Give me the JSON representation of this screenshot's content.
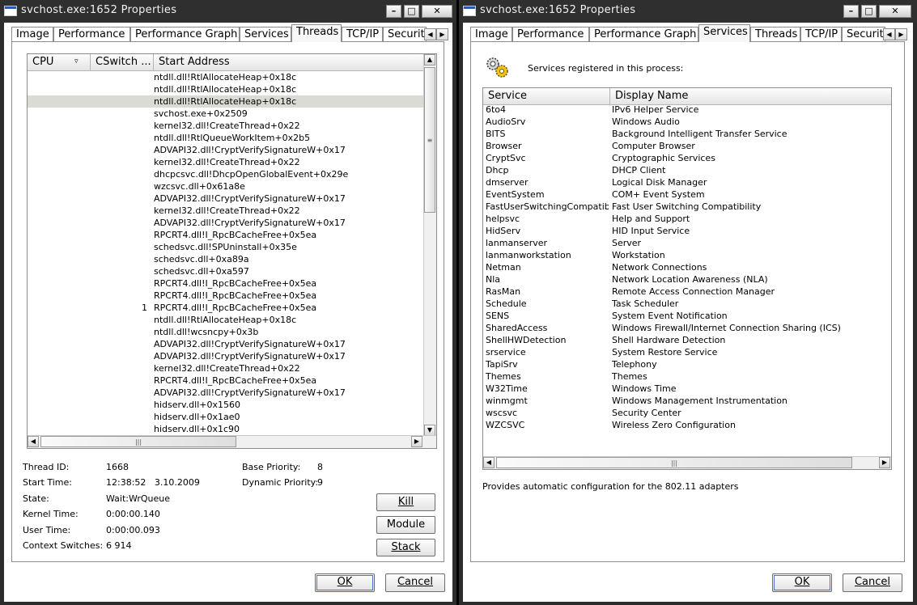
{
  "left": {
    "title": "svchost.exe:1652 Properties",
    "tabs": [
      "Image",
      "Performance",
      "Performance Graph",
      "Services",
      "Threads",
      "TCP/IP",
      "Securit"
    ],
    "selected_tab": "Threads",
    "columns": [
      "CPU",
      "CSwitch ...",
      "Start Address"
    ],
    "threads": [
      {
        "cpu": "",
        "cs": "",
        "addr": "ntdll.dll!RtlAllocateHeap+0x18c"
      },
      {
        "cpu": "",
        "cs": "",
        "addr": "ntdll.dll!RtlAllocateHeap+0x18c"
      },
      {
        "cpu": "",
        "cs": "",
        "addr": "ntdll.dll!RtlAllocateHeap+0x18c"
      },
      {
        "cpu": "",
        "cs": "",
        "addr": "svchost.exe+0x2509"
      },
      {
        "cpu": "",
        "cs": "",
        "addr": "kernel32.dll!CreateThread+0x22"
      },
      {
        "cpu": "",
        "cs": "",
        "addr": "ntdll.dll!RtlQueueWorkItem+0x2b5"
      },
      {
        "cpu": "",
        "cs": "",
        "addr": "ADVAPI32.dll!CryptVerifySignatureW+0x17"
      },
      {
        "cpu": "",
        "cs": "",
        "addr": "kernel32.dll!CreateThread+0x22"
      },
      {
        "cpu": "",
        "cs": "",
        "addr": "dhcpcsvc.dll!DhcpOpenGlobalEvent+0x29e"
      },
      {
        "cpu": "",
        "cs": "",
        "addr": "wzcsvc.dll+0x61a8e"
      },
      {
        "cpu": "",
        "cs": "",
        "addr": "ADVAPI32.dll!CryptVerifySignatureW+0x17"
      },
      {
        "cpu": "",
        "cs": "",
        "addr": "kernel32.dll!CreateThread+0x22"
      },
      {
        "cpu": "",
        "cs": "",
        "addr": "ADVAPI32.dll!CryptVerifySignatureW+0x17"
      },
      {
        "cpu": "",
        "cs": "",
        "addr": "RPCRT4.dll!I_RpcBCacheFree+0x5ea"
      },
      {
        "cpu": "",
        "cs": "",
        "addr": "schedsvc.dll!SPUninstall+0x35e"
      },
      {
        "cpu": "",
        "cs": "",
        "addr": "schedsvc.dll+0xa89a"
      },
      {
        "cpu": "",
        "cs": "",
        "addr": "schedsvc.dll+0xa597"
      },
      {
        "cpu": "",
        "cs": "",
        "addr": "RPCRT4.dll!I_RpcBCacheFree+0x5ea"
      },
      {
        "cpu": "",
        "cs": "",
        "addr": "RPCRT4.dll!I_RpcBCacheFree+0x5ea"
      },
      {
        "cpu": "",
        "cs": "1",
        "addr": "RPCRT4.dll!I_RpcBCacheFree+0x5ea"
      },
      {
        "cpu": "",
        "cs": "",
        "addr": "ntdll.dll!RtlAllocateHeap+0x18c"
      },
      {
        "cpu": "",
        "cs": "",
        "addr": "ntdll.dll!wcsncpy+0x3b"
      },
      {
        "cpu": "",
        "cs": "",
        "addr": "ADVAPI32.dll!CryptVerifySignatureW+0x17"
      },
      {
        "cpu": "",
        "cs": "",
        "addr": "ADVAPI32.dll!CryptVerifySignatureW+0x17"
      },
      {
        "cpu": "",
        "cs": "",
        "addr": "kernel32.dll!CreateThread+0x22"
      },
      {
        "cpu": "",
        "cs": "",
        "addr": "RPCRT4.dll!I_RpcBCacheFree+0x5ea"
      },
      {
        "cpu": "",
        "cs": "",
        "addr": "ADVAPI32.dll!CryptVerifySignatureW+0x17"
      },
      {
        "cpu": "",
        "cs": "",
        "addr": "hidserv.dll+0x1560"
      },
      {
        "cpu": "",
        "cs": "",
        "addr": "hidserv.dll+0x1ae0"
      },
      {
        "cpu": "",
        "cs": "",
        "addr": "hidserv.dll+0x1c90"
      }
    ],
    "details": {
      "thread_id_label": "Thread ID:",
      "thread_id": "1668",
      "start_time_label": "Start Time:",
      "start_time": "12:38:52   3.10.2009",
      "state_label": "State:",
      "state": "Wait:WrQueue",
      "kernel_time_label": "Kernel Time:",
      "kernel_time": "0:00:00.140",
      "user_time_label": "User Time:",
      "user_time": "0:00:00.093",
      "context_switches_label": "Context Switches:",
      "context_switches": "6 914",
      "base_priority_label": "Base Priority:",
      "base_priority": "8",
      "dynamic_priority_label": "Dynamic Priority:",
      "dynamic_priority": "9"
    },
    "buttons": {
      "kill": "Kill",
      "module": "Module",
      "stack": "Stack",
      "ok": "OK",
      "cancel": "Cancel"
    }
  },
  "right": {
    "title": "svchost.exe:1652 Properties",
    "tabs": [
      "Image",
      "Performance",
      "Performance Graph",
      "Services",
      "Threads",
      "TCP/IP",
      "Securit"
    ],
    "selected_tab": "Services",
    "heading": "Services registered in this process:",
    "columns": [
      "Service",
      "Display Name"
    ],
    "services": [
      {
        "name": "6to4",
        "display": "IPv6 Helper Service"
      },
      {
        "name": "AudioSrv",
        "display": "Windows Audio"
      },
      {
        "name": "BITS",
        "display": "Background Intelligent Transfer Service"
      },
      {
        "name": "Browser",
        "display": "Computer Browser"
      },
      {
        "name": "CryptSvc",
        "display": "Cryptographic Services"
      },
      {
        "name": "Dhcp",
        "display": "DHCP Client"
      },
      {
        "name": "dmserver",
        "display": "Logical Disk Manager"
      },
      {
        "name": "EventSystem",
        "display": "COM+ Event System"
      },
      {
        "name": "FastUserSwitchingCompatibility",
        "display": "Fast User Switching Compatibility"
      },
      {
        "name": "helpsvc",
        "display": "Help and Support"
      },
      {
        "name": "HidServ",
        "display": "HID Input Service"
      },
      {
        "name": "lanmanserver",
        "display": "Server"
      },
      {
        "name": "lanmanworkstation",
        "display": "Workstation"
      },
      {
        "name": "Netman",
        "display": "Network Connections"
      },
      {
        "name": "Nla",
        "display": "Network Location Awareness (NLA)"
      },
      {
        "name": "RasMan",
        "display": "Remote Access Connection Manager"
      },
      {
        "name": "Schedule",
        "display": "Task Scheduler"
      },
      {
        "name": "SENS",
        "display": "System Event Notification"
      },
      {
        "name": "SharedAccess",
        "display": "Windows Firewall/Internet Connection Sharing (ICS)"
      },
      {
        "name": "ShellHWDetection",
        "display": "Shell Hardware Detection"
      },
      {
        "name": "srservice",
        "display": "System Restore Service"
      },
      {
        "name": "TapiSrv",
        "display": "Telephony"
      },
      {
        "name": "Themes",
        "display": "Themes"
      },
      {
        "name": "W32Time",
        "display": "Windows Time"
      },
      {
        "name": "winmgmt",
        "display": "Windows Management Instrumentation"
      },
      {
        "name": "wscsvc",
        "display": "Security Center"
      },
      {
        "name": "WZCSVC",
        "display": "Wireless Zero Configuration"
      }
    ],
    "description": "Provides automatic configuration for the 802.11 adapters",
    "buttons": {
      "ok": "OK",
      "cancel": "Cancel"
    }
  }
}
